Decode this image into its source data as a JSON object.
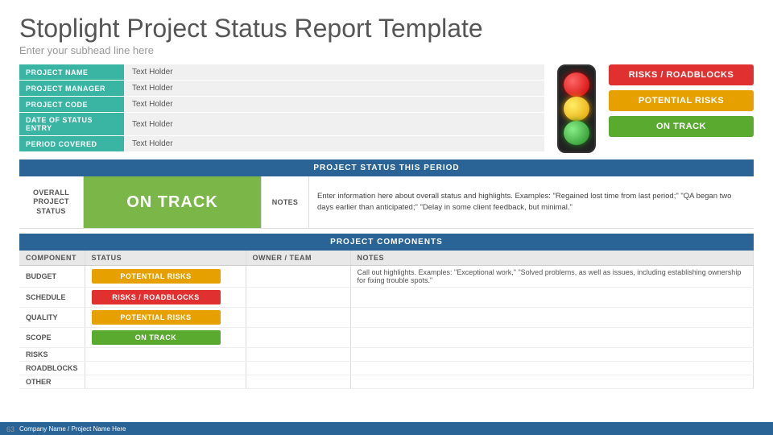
{
  "header": {
    "title": "Stoplight Project Status Report Template",
    "subhead": "Enter your subhead line here"
  },
  "info_rows": [
    {
      "label": "PROJECT NAME",
      "value": "Text Holder"
    },
    {
      "label": "PROJECT MANAGER",
      "value": "Text Holder"
    },
    {
      "label": "PROJECT CODE",
      "value": "Text Holder"
    },
    {
      "label": "DATE OF STATUS ENTRY",
      "value": "Text Holder"
    },
    {
      "label": "PERIOD COVERED",
      "value": "Text Holder"
    }
  ],
  "legend": [
    {
      "label": "RISKS / ROADBLOCKS",
      "color_class": "legend-red"
    },
    {
      "label": "POTENTIAL RISKS",
      "color_class": "legend-yellow"
    },
    {
      "label": "ON TRACK",
      "color_class": "legend-green"
    }
  ],
  "project_status": {
    "section_title": "PROJECT STATUS THIS PERIOD",
    "overall_label": "OVERALL\nPROJECT\nSTATUS",
    "status_value": "ON TRACK",
    "notes_label": "NOTES",
    "notes_text": "Enter information here about overall status and highlights. Examples: \"Regained lost time from last period;\" \"QA began two days earlier than anticipated;\" \"Delay in some client feedback, but minimal.\""
  },
  "components": {
    "section_title": "PROJECT COMPONENTS",
    "columns": [
      "COMPONENT",
      "STATUS",
      "OWNER / TEAM",
      "NOTES"
    ],
    "rows": [
      {
        "component": "BUDGET",
        "status": "POTENTIAL RISKS",
        "status_class": "pill-yellow",
        "owner": "",
        "notes": "Call out highlights. Examples: \"Exceptional work,\" \"Solved problems, as well as issues, including establishing ownership for fixing trouble spots.\""
      },
      {
        "component": "SCHEDULE",
        "status": "RISKS / ROADBLOCKS",
        "status_class": "pill-red",
        "owner": "",
        "notes": ""
      },
      {
        "component": "QUALITY",
        "status": "POTENTIAL RISKS",
        "status_class": "pill-yellow",
        "owner": "",
        "notes": ""
      },
      {
        "component": "SCOPE",
        "status": "ON TRACK",
        "status_class": "pill-green",
        "owner": "",
        "notes": ""
      },
      {
        "component": "RISKS",
        "status": "",
        "status_class": "",
        "owner": "",
        "notes": ""
      },
      {
        "component": "ROADBLOCKS",
        "status": "",
        "status_class": "",
        "owner": "",
        "notes": ""
      },
      {
        "component": "OTHER",
        "status": "",
        "status_class": "",
        "owner": "",
        "notes": ""
      }
    ]
  },
  "footer": {
    "text": "Company Name / Project Name Here",
    "page_num": "63"
  }
}
